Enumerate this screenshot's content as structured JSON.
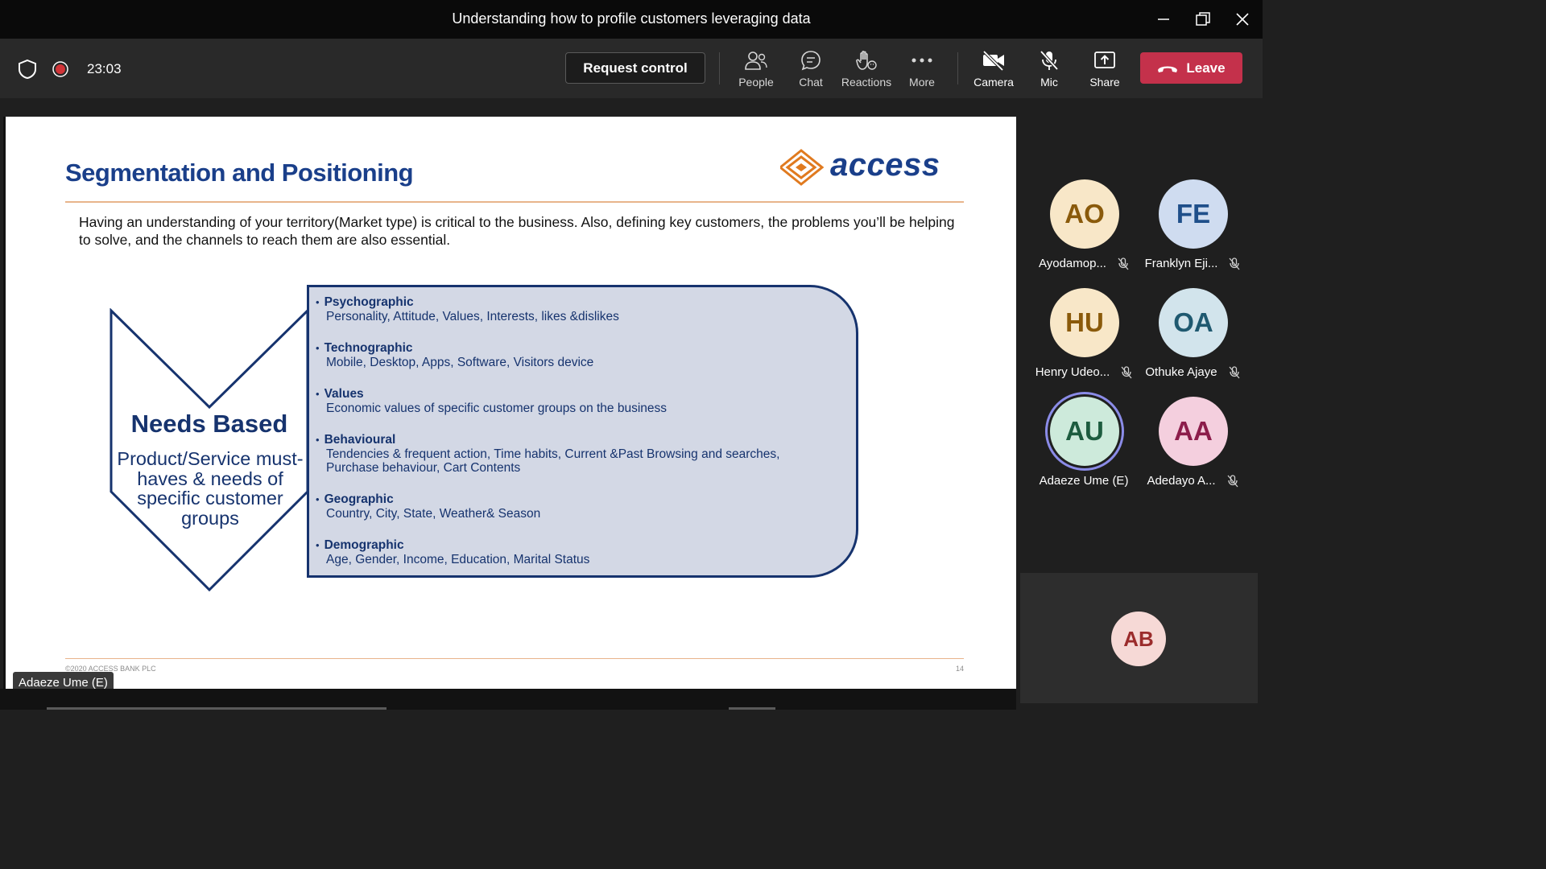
{
  "window": {
    "title": "Understanding how to profile customers leveraging data"
  },
  "toolbar": {
    "timer": "23:03",
    "request_control": "Request control",
    "items": [
      {
        "label": "People",
        "icon": "people-icon"
      },
      {
        "label": "Chat",
        "icon": "chat-icon"
      },
      {
        "label": "Reactions",
        "icon": "reactions-icon"
      },
      {
        "label": "More",
        "icon": "more-icon"
      },
      {
        "label": "Camera",
        "icon": "camera-off-icon"
      },
      {
        "label": "Mic",
        "icon": "mic-off-icon"
      },
      {
        "label": "Share",
        "icon": "share-icon"
      }
    ],
    "leave": "Leave",
    "leave_color": "#c4314b"
  },
  "slide": {
    "title": "Segmentation and Positioning",
    "logo_text": "access",
    "intro": "Having an understanding of your territory(Market type) is critical to the business. Also, defining key customers, the problems you’ll be helping to solve, and the channels to reach them are also essential.",
    "needs_title": "Needs Based",
    "needs_sub": "Product/Service must-haves & needs of specific customer groups",
    "items": [
      {
        "head": "Psychographic",
        "desc": "Personality, Attitude, Values, Interests, likes &dislikes"
      },
      {
        "head": "Technographic",
        "desc": "Mobile, Desktop, Apps, Software, Visitors device"
      },
      {
        "head": "Values",
        "desc": "Economic values of specific customer groups on the business"
      },
      {
        "head": "Behavioural",
        "desc": "Tendencies & frequent action, Time habits, Current &Past Browsing and searches, Purchase behaviour, Cart Contents"
      },
      {
        "head": "Geographic",
        "desc": "Country, City, State, Weather& Season"
      },
      {
        "head": "Demographic",
        "desc": "Age, Gender, Income, Education, Marital Status"
      }
    ],
    "copyright": "©2020 ACCESS BANK PLC",
    "page": "14"
  },
  "presenter": "Adaeze Ume (E)",
  "participants": [
    {
      "initials": "AO",
      "name": "Ayodamop...",
      "bg": "#f8e7c8",
      "fg": "#8a5a0b",
      "muted": true
    },
    {
      "initials": "FE",
      "name": "Franklyn Eji...",
      "bg": "#cfdcf0",
      "fg": "#1f4f8a",
      "muted": true
    },
    {
      "initials": "HU",
      "name": "Henry Udeo...",
      "bg": "#f8e7c8",
      "fg": "#8a5a0b",
      "muted": true
    },
    {
      "initials": "OA",
      "name": "Othuke Ajaye",
      "bg": "#d2e4ec",
      "fg": "#1f5970",
      "muted": true
    },
    {
      "initials": "AU",
      "name": "Adaeze Ume (E)",
      "bg": "#cdeadb",
      "fg": "#1d5c3f",
      "muted": false
    },
    {
      "initials": "AA",
      "name": "Adedayo A...",
      "bg": "#f4cfde",
      "fg": "#8c1d4b",
      "muted": true
    }
  ],
  "self": {
    "initials": "AB"
  }
}
